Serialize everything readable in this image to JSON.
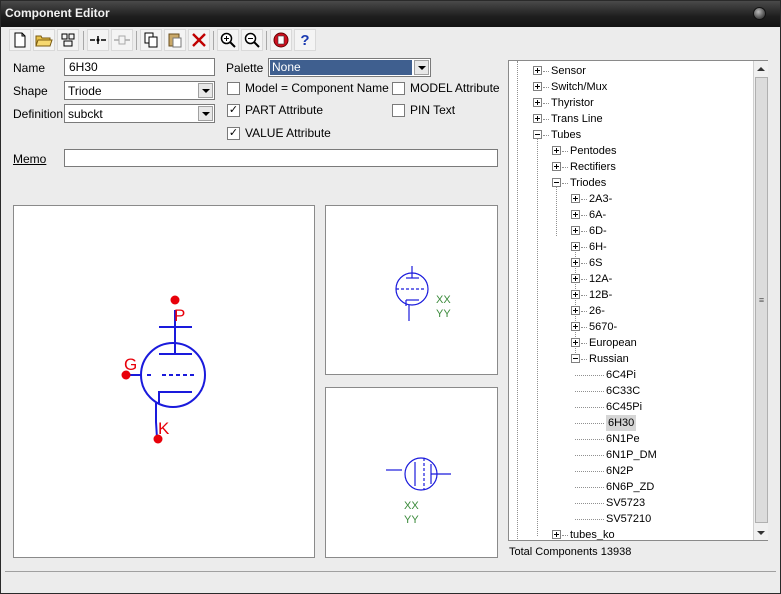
{
  "window": {
    "title": "Component Editor"
  },
  "toolbar": {
    "buttons": [
      "new-icon",
      "open-folder-icon",
      "symbol-icon",
      "pin-icon",
      "pin-grid-icon",
      "copy-icon",
      "paste-icon",
      "delete-icon",
      "zoom-in-icon",
      "zoom-out-icon",
      "stop-icon",
      "help-icon"
    ],
    "help_glyph": "?"
  },
  "form": {
    "name_label": "Name",
    "name_value": "6H30",
    "shape_label": "Shape",
    "shape_value": "Triode",
    "definition_label": "Definition",
    "definition_value": "subckt",
    "memo_label": "Memo",
    "memo_value": "",
    "palette_label": "Palette",
    "palette_value": "None"
  },
  "checkboxes": [
    {
      "label": "Model = Component Name",
      "checked": false
    },
    {
      "label": "MODEL Attribute",
      "checked": false
    },
    {
      "label": "PART Attribute",
      "checked": true
    },
    {
      "label": "PIN Text",
      "checked": false
    },
    {
      "label": "VALUE Attribute",
      "checked": true
    }
  ],
  "check_glyph": "✓",
  "schematic": {
    "pins": {
      "plate": "P",
      "grid": "G",
      "cathode": "K"
    },
    "attr_x": "XX",
    "attr_y": "YY",
    "colors": {
      "symbol": "#1a1adc",
      "pin": "#e8000a",
      "attr": "#3a8a3a"
    }
  },
  "tree": {
    "items": [
      {
        "label": "Sensor",
        "expander": "plus"
      },
      {
        "label": "Switch/Mux",
        "expander": "plus"
      },
      {
        "label": "Thyristor",
        "expander": "plus"
      },
      {
        "label": "Trans Line",
        "expander": "plus"
      },
      {
        "label": "Tubes",
        "expander": "minus"
      },
      {
        "label": "Pentodes",
        "expander": "plus"
      },
      {
        "label": "Rectifiers",
        "expander": "plus"
      },
      {
        "label": "Triodes",
        "expander": "minus"
      },
      {
        "label": "2A3-",
        "expander": "plus"
      },
      {
        "label": "6A-",
        "expander": "plus"
      },
      {
        "label": "6D-",
        "expander": "plus"
      },
      {
        "label": "6H-",
        "expander": "plus"
      },
      {
        "label": "6S",
        "expander": "plus"
      },
      {
        "label": "12A-",
        "expander": "plus"
      },
      {
        "label": "12B-",
        "expander": "plus"
      },
      {
        "label": "26-",
        "expander": "plus"
      },
      {
        "label": "5670-",
        "expander": "plus"
      },
      {
        "label": "European",
        "expander": "plus"
      },
      {
        "label": "Russian",
        "expander": "minus"
      },
      {
        "label": "6C4Pi",
        "expander": "none"
      },
      {
        "label": "6C33C",
        "expander": "none"
      },
      {
        "label": "6C45Pi",
        "expander": "none"
      },
      {
        "label": "6H30",
        "expander": "none",
        "selected": true
      },
      {
        "label": "6N1Pe",
        "expander": "none"
      },
      {
        "label": "6N1P_DM",
        "expander": "none"
      },
      {
        "label": "6N2P",
        "expander": "none"
      },
      {
        "label": "6N6P_ZD",
        "expander": "none"
      },
      {
        "label": "SV5723",
        "expander": "none"
      },
      {
        "label": "SV57210",
        "expander": "none"
      },
      {
        "label": "tubes_ko",
        "expander": "plus"
      }
    ],
    "scroll_thumb_glyph": "≡"
  },
  "status": {
    "total_components": "Total Components 13938"
  }
}
